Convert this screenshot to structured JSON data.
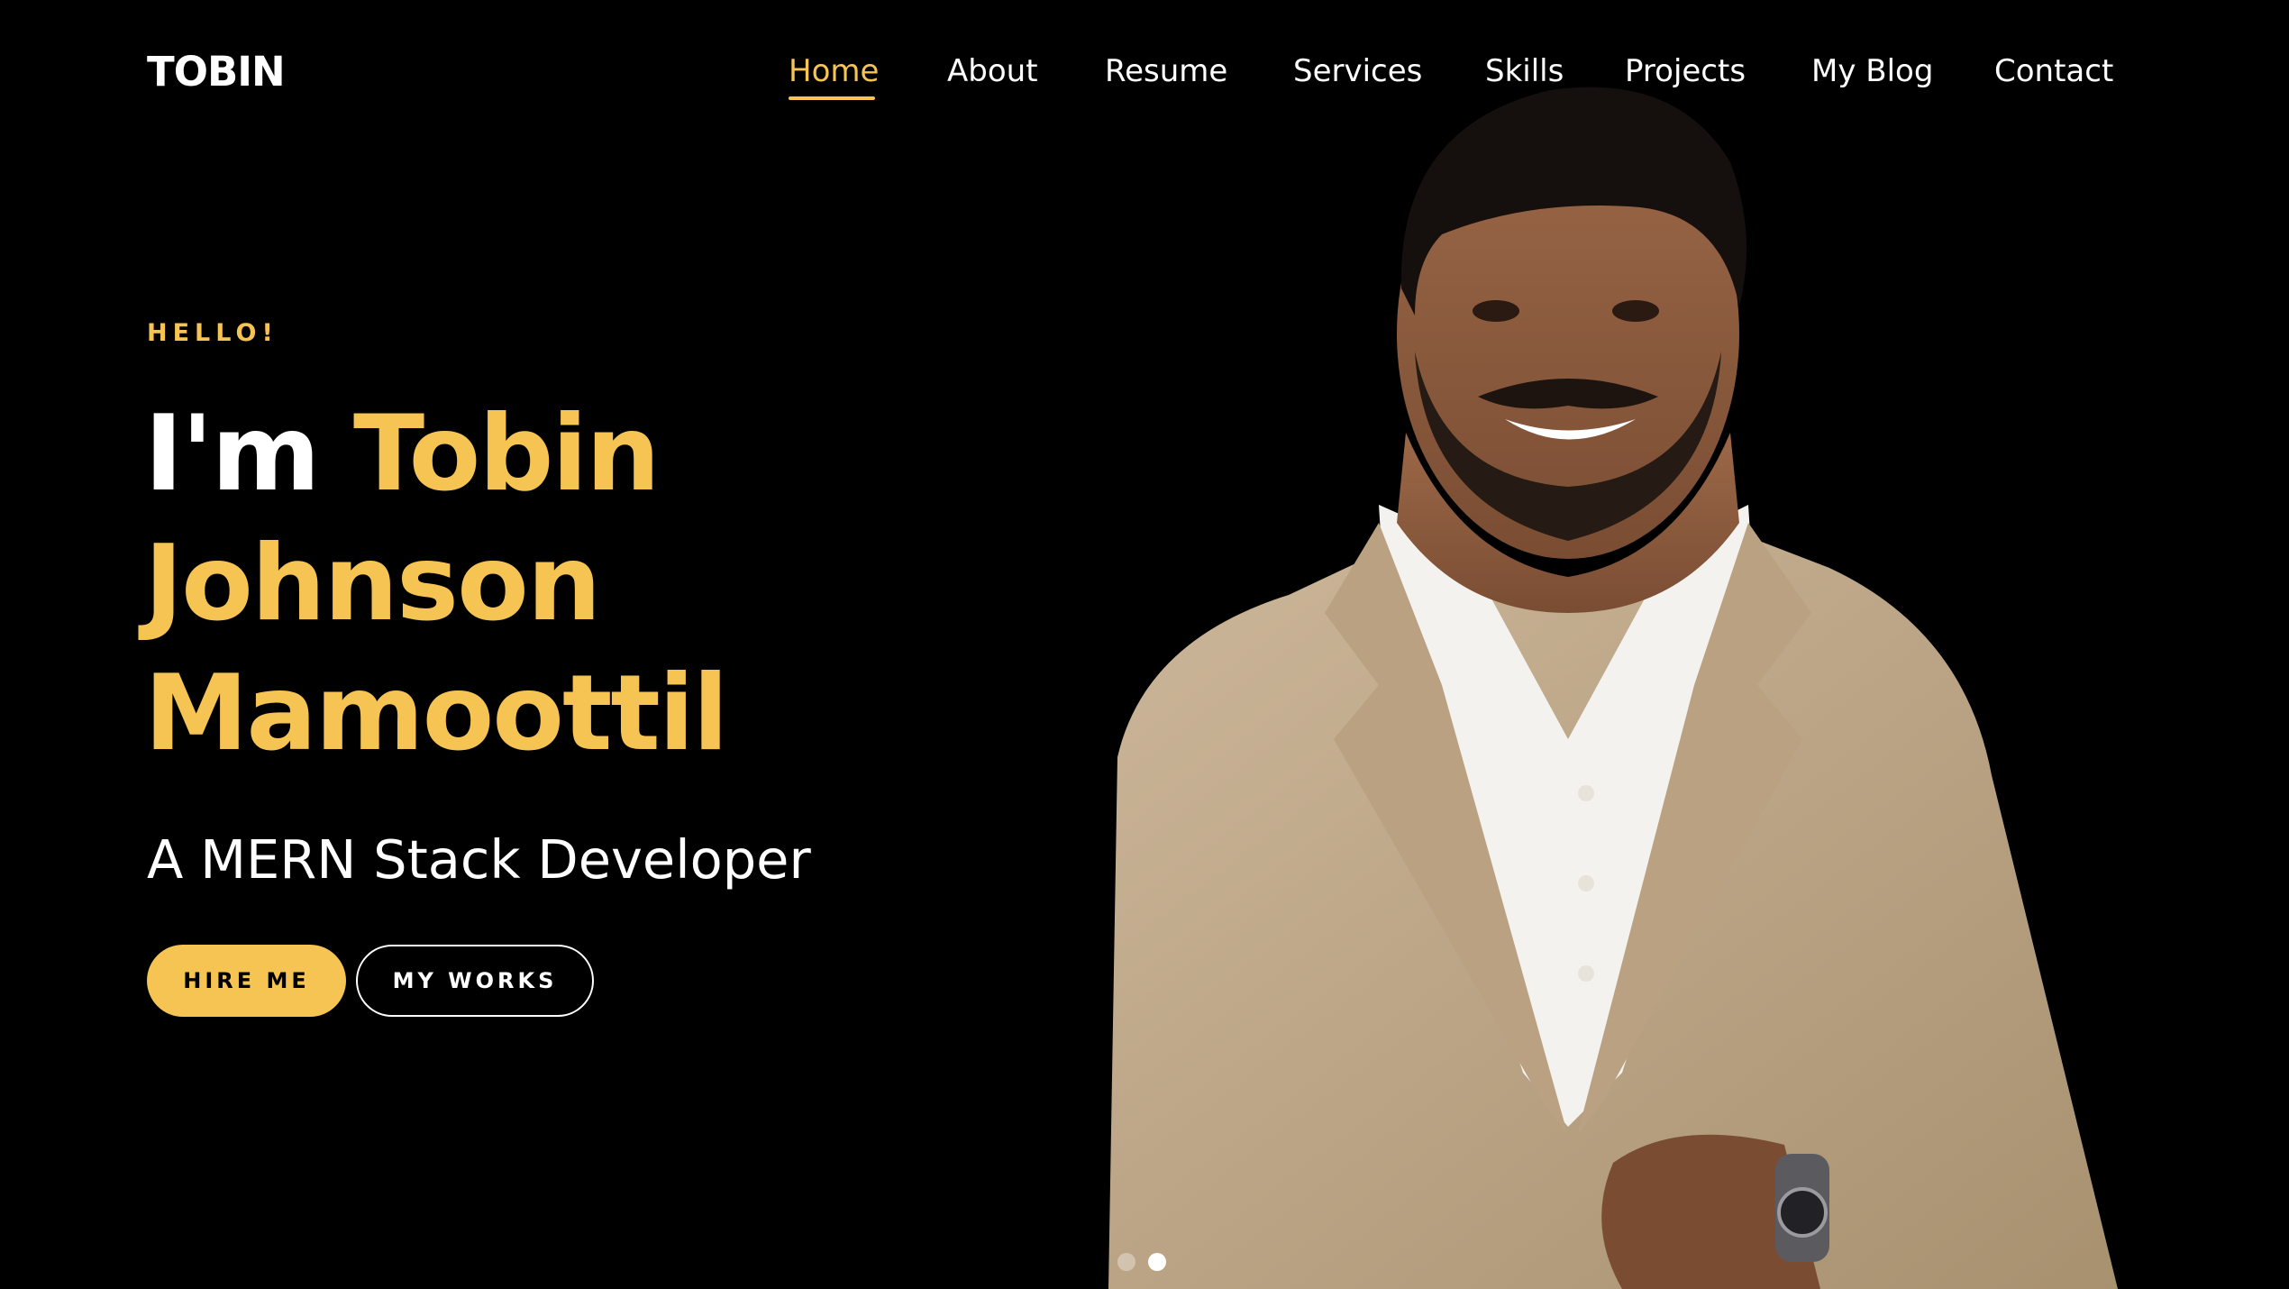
{
  "brand": {
    "logo_text": "TOBIN"
  },
  "nav": {
    "items": [
      {
        "label": "Home",
        "active": true
      },
      {
        "label": "About"
      },
      {
        "label": "Resume"
      },
      {
        "label": "Services"
      },
      {
        "label": "Skills"
      },
      {
        "label": "Projects"
      },
      {
        "label": "My Blog"
      },
      {
        "label": "Contact"
      }
    ]
  },
  "hero": {
    "greeting": "HELLO!",
    "headline_prefix": "I'm",
    "name_line1": "Tobin",
    "name_line2": "Johnson",
    "name_line3": "Mamoottil",
    "role": "A MERN Stack Developer",
    "primary_button": "HIRE ME",
    "secondary_button": "MY WORKS"
  },
  "carousel": {
    "slides": 2,
    "active_index": 1
  },
  "colors": {
    "background": "#000000",
    "accent": "#f6c453",
    "text": "#ffffff"
  },
  "icons": [
    "portrait-photo"
  ]
}
